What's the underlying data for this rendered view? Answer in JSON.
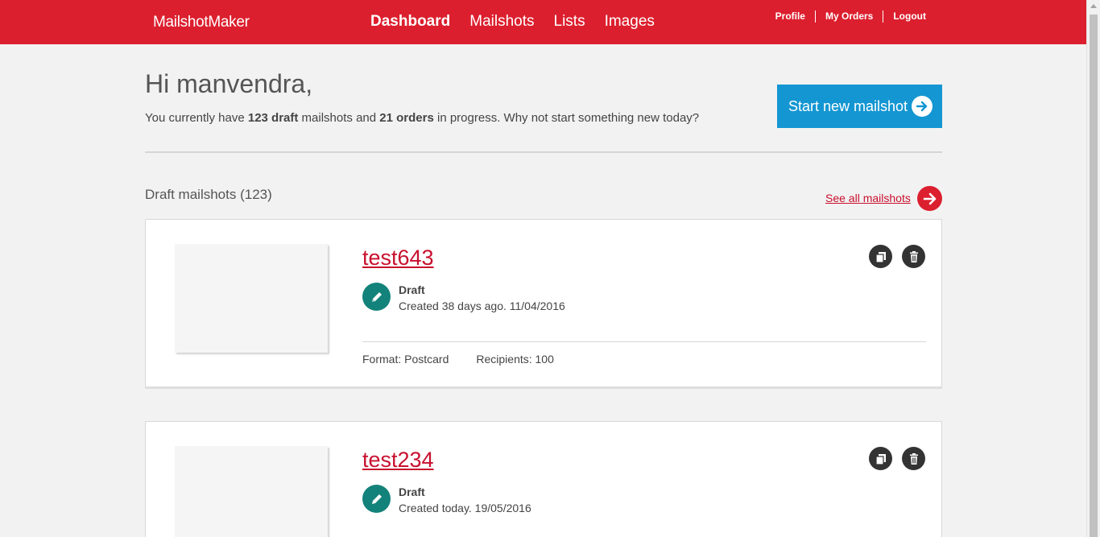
{
  "header": {
    "logo": "MailshotMaker",
    "nav": [
      "Dashboard",
      "Mailshots",
      "Lists",
      "Images"
    ],
    "user_links": [
      "Profile",
      "My Orders",
      "Logout"
    ]
  },
  "greeting": "Hi manvendra,",
  "summary": {
    "prefix": "You currently have ",
    "draft_count": "123 draft",
    "middle": " mailshots and ",
    "order_count": "21 orders",
    "suffix": " in progress. Why not start something new today?"
  },
  "start_button": "Start new mailshot",
  "drafts": {
    "title": "Draft mailshots (123)",
    "see_all": "See all mailshots",
    "items": [
      {
        "name": "test643",
        "status": "Draft",
        "created": "Created 38 days ago. 11/04/2016",
        "format": "Format: Postcard",
        "recipients": "Recipients: 100"
      },
      {
        "name": "test234",
        "status": "Draft",
        "created": "Created today. 19/05/2016"
      }
    ]
  },
  "colors": {
    "brand_red": "#dc1f2e",
    "button_blue": "#1496d2",
    "status_teal": "#12827a",
    "link_red": "#c8102e"
  },
  "icons": {
    "start_arrow": "arrow-right-icon",
    "status": "pencil-icon",
    "copy": "copy-icon",
    "delete": "trash-icon"
  }
}
